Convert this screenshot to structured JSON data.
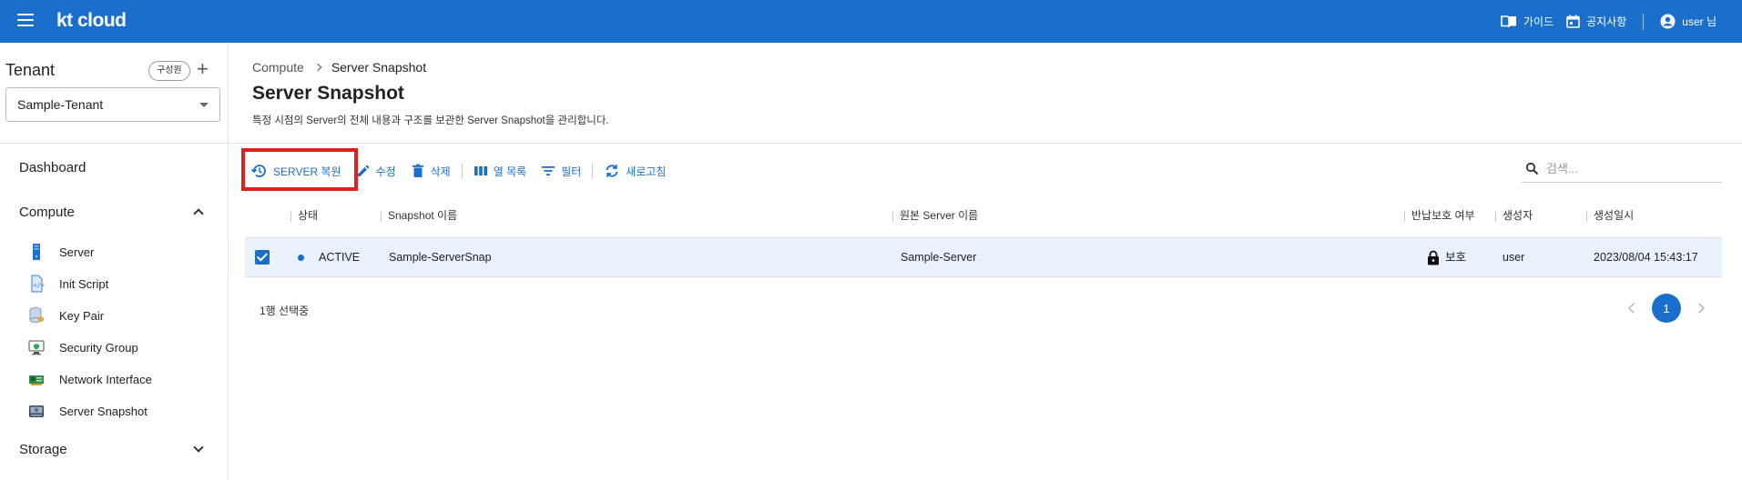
{
  "header": {
    "logo": "kt cloud",
    "nav": [
      {
        "label": "가이드",
        "icon": "book-icon"
      },
      {
        "label": "공지사항",
        "icon": "calendar-icon"
      },
      {
        "label": "user 님",
        "icon": "account-icon"
      }
    ],
    "color": "#1a6fcc"
  },
  "sidebar": {
    "tenant_title": "Tenant",
    "member_button": "구성원",
    "tenant_selected": "Sample-Tenant",
    "dashboard": "Dashboard",
    "compute": "Compute",
    "compute_items": [
      {
        "label": "Server",
        "icon": "server-icon"
      },
      {
        "label": "Init Script",
        "icon": "script-icon"
      },
      {
        "label": "Key Pair",
        "icon": "key-pair-icon"
      },
      {
        "label": "Security Group",
        "icon": "security-group-icon"
      },
      {
        "label": "Network Interface",
        "icon": "network-interface-icon"
      },
      {
        "label": "Server Snapshot",
        "icon": "server-snapshot-icon"
      }
    ],
    "storage": "Storage"
  },
  "main": {
    "breadcrumb": [
      "Compute",
      "Server Snapshot"
    ],
    "title": "Server Snapshot",
    "description": "특정 시점의 Server의 전체 내용과 구조를 보관한 Server Snapshot을 관리합니다.",
    "toolbar": {
      "restore": "SERVER 복원",
      "edit": "수정",
      "delete": "삭제",
      "columns": "열 목록",
      "filter": "필터",
      "refresh": "새로고침"
    },
    "search_placeholder": "검색...",
    "table": {
      "headers": [
        "상태",
        "Snapshot 이름",
        "원본 Server 이름",
        "반납보호 여부",
        "생성자",
        "생성일시"
      ],
      "rows": [
        {
          "status": "ACTIVE",
          "snapshot_name": "Sample-ServerSnap",
          "source_server": "Sample-Server",
          "protection": "보호",
          "creator": "user",
          "created_at": "2023/08/04 15:43:17"
        }
      ]
    },
    "selection_note": "1행 선택중",
    "page": "1"
  }
}
